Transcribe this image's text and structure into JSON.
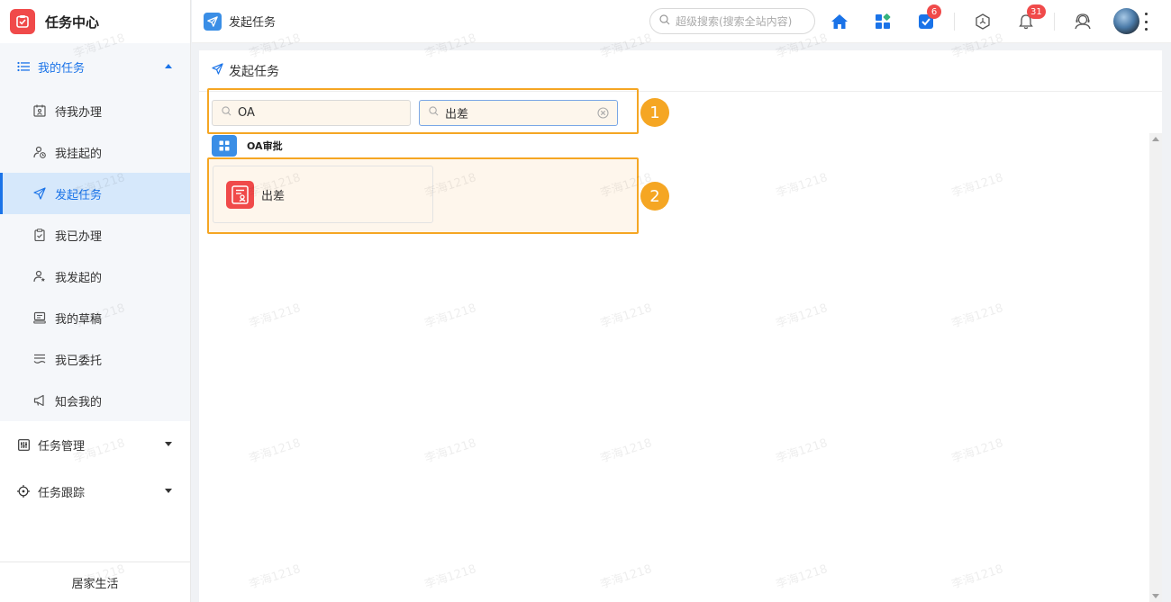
{
  "sidebar": {
    "brand_title": "任务中心",
    "groups": [
      {
        "label": "我的任务"
      },
      {
        "label": "任务管理"
      },
      {
        "label": "任务跟踪"
      }
    ],
    "items": [
      {
        "label": "待我办理"
      },
      {
        "label": "我挂起的"
      },
      {
        "label": "发起任务"
      },
      {
        "label": "我已办理"
      },
      {
        "label": "我发起的"
      },
      {
        "label": "我的草稿"
      },
      {
        "label": "我已委托"
      },
      {
        "label": "知会我的"
      }
    ],
    "footer": "居家生活"
  },
  "topbar": {
    "page_tab": "发起任务",
    "search_placeholder": "超级搜索(搜索全站内容)",
    "todo_badge": "6",
    "notification_badge": "31"
  },
  "content": {
    "title": "发起任务",
    "filter_category_value": "OA",
    "filter_task_value": "出差",
    "group_label": "OA审批",
    "task_card_label": "出差",
    "steps": [
      "1",
      "2"
    ]
  },
  "watermark": "李海1218",
  "colors": {
    "accent": "#1a73e8",
    "brand_red": "#f04a4a",
    "highlight_orange": "#f5a623",
    "active_bg": "#d6e8fb"
  }
}
